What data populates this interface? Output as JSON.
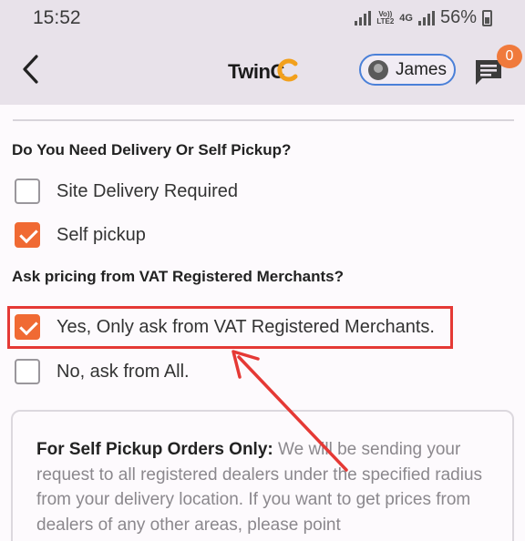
{
  "status": {
    "time": "15:52",
    "network_top": "Vo))",
    "network_bottom": "LTE2",
    "net_type": "4G",
    "battery": "56%"
  },
  "header": {
    "logo": "TwinC",
    "user_name": "James",
    "notification_count": "0"
  },
  "delivery": {
    "question": "Do You Need Delivery Or Self Pickup?",
    "options": [
      {
        "label": "Site Delivery Required",
        "checked": false
      },
      {
        "label": "Self pickup",
        "checked": true
      }
    ]
  },
  "vat": {
    "question": "Ask pricing from VAT Registered Merchants?",
    "options": [
      {
        "label": "Yes, Only ask from VAT Registered Merchants.",
        "checked": true
      },
      {
        "label": "No, ask from All.",
        "checked": false
      }
    ]
  },
  "info": {
    "heading": "For Self Pickup Orders Only:",
    "body": " We will be sending your request to all registered dealers under the specified radius from your delivery location. If you want to get prices from dealers of any other areas, please point"
  },
  "colors": {
    "accent": "#f06a33",
    "highlight": "#e53935",
    "pill_border": "#4a80d8"
  }
}
